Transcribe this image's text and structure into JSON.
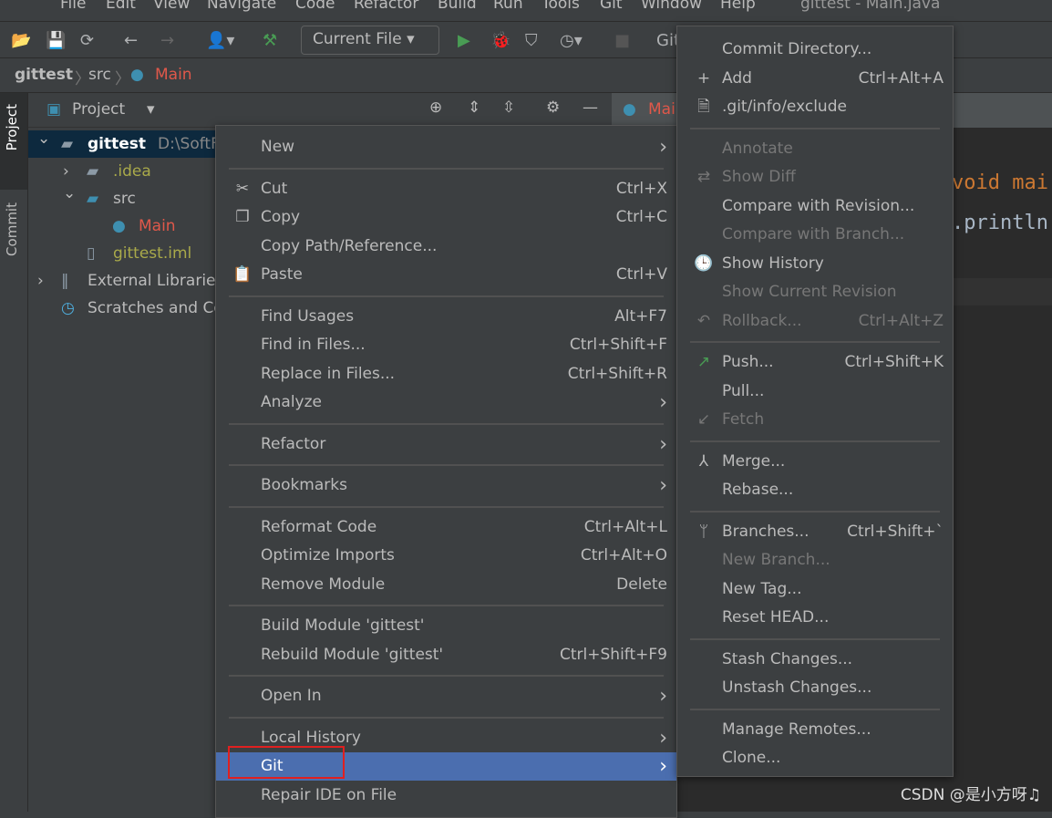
{
  "menubar": [
    "File",
    "Edit",
    "View",
    "Navigate",
    "Code",
    "Refactor",
    "Build",
    "Run",
    "Tools",
    "Git",
    "Window",
    "Help"
  ],
  "window_title": "gittest - Main.java",
  "toolbar": {
    "run_config": "Current File",
    "git_label": "Git:"
  },
  "breadcrumb": [
    "gittest",
    "src",
    "Main"
  ],
  "side_tabs": {
    "project": "Project",
    "commit": "Commit"
  },
  "project_panel": {
    "title": "Project"
  },
  "tree": [
    {
      "label": "gittest",
      "extra": "D:\\SoftFi",
      "icon": "module-folder-icon",
      "expanded": true,
      "color": "#ffffff",
      "indent": 0
    },
    {
      "label": ".idea",
      "icon": "folder-icon",
      "expanded": false,
      "color": "#a9a94a",
      "indent": 1
    },
    {
      "label": "src",
      "icon": "source-folder-icon",
      "expanded": true,
      "color": "#bbbbbb",
      "indent": 1
    },
    {
      "label": "Main",
      "icon": "java-class-icon",
      "color": "#e0584a",
      "indent": 2
    },
    {
      "label": "gittest.iml",
      "icon": "iml-file-icon",
      "color": "#a9a94a",
      "indent": 1
    },
    {
      "label": "External Librarie",
      "icon": "library-icon",
      "expanded": false,
      "color": "#bbbbbb",
      "indent": 0
    },
    {
      "label": "Scratches and Co",
      "icon": "scratches-icon",
      "color": "#bbbbbb",
      "indent": 0
    }
  ],
  "editor": {
    "tab": "Main",
    "code": [
      "void mai",
      ".println"
    ]
  },
  "context_menu": [
    {
      "label": "New",
      "submenu": true
    },
    {
      "sep": true
    },
    {
      "label": "Cut",
      "shortcut": "Ctrl+X",
      "icon": "✂"
    },
    {
      "label": "Copy",
      "shortcut": "Ctrl+C",
      "icon": "❐"
    },
    {
      "label": "Copy Path/Reference..."
    },
    {
      "label": "Paste",
      "shortcut": "Ctrl+V",
      "icon": "📋"
    },
    {
      "sep": true
    },
    {
      "label": "Find Usages",
      "shortcut": "Alt+F7"
    },
    {
      "label": "Find in Files...",
      "shortcut": "Ctrl+Shift+F"
    },
    {
      "label": "Replace in Files...",
      "shortcut": "Ctrl+Shift+R"
    },
    {
      "label": "Analyze",
      "submenu": true
    },
    {
      "sep": true
    },
    {
      "label": "Refactor",
      "submenu": true
    },
    {
      "sep": true
    },
    {
      "label": "Bookmarks",
      "submenu": true
    },
    {
      "sep": true
    },
    {
      "label": "Reformat Code",
      "shortcut": "Ctrl+Alt+L"
    },
    {
      "label": "Optimize Imports",
      "shortcut": "Ctrl+Alt+O"
    },
    {
      "label": "Remove Module",
      "shortcut": "Delete"
    },
    {
      "sep": true
    },
    {
      "label": "Build Module 'gittest'"
    },
    {
      "label": "Rebuild Module 'gittest'",
      "shortcut": "Ctrl+Shift+F9"
    },
    {
      "sep": true
    },
    {
      "label": "Open In",
      "submenu": true
    },
    {
      "sep": true
    },
    {
      "label": "Local History",
      "submenu": true
    },
    {
      "label": "Git",
      "submenu": true,
      "selected": true
    },
    {
      "label": "Repair IDE on File"
    }
  ],
  "git_menu": [
    {
      "label": "Commit Directory..."
    },
    {
      "label": "Add",
      "shortcut": "Ctrl+Alt+A",
      "icon": "+"
    },
    {
      "label": ".git/info/exclude",
      "icon": "🗎"
    },
    {
      "sep": true
    },
    {
      "label": "Annotate",
      "disabled": true
    },
    {
      "label": "Show Diff",
      "disabled": true,
      "icon": "⇄"
    },
    {
      "label": "Compare with Revision..."
    },
    {
      "label": "Compare with Branch...",
      "disabled": true
    },
    {
      "label": "Show History",
      "icon": "🕒"
    },
    {
      "label": "Show Current Revision",
      "disabled": true
    },
    {
      "label": "Rollback...",
      "shortcut": "Ctrl+Alt+Z",
      "disabled": true,
      "icon": "↶"
    },
    {
      "sep": true
    },
    {
      "label": "Push...",
      "shortcut": "Ctrl+Shift+K",
      "icon": "↗"
    },
    {
      "label": "Pull..."
    },
    {
      "label": "Fetch",
      "disabled": true,
      "icon": "↙"
    },
    {
      "sep": true
    },
    {
      "label": "Merge...",
      "icon": "⅄"
    },
    {
      "label": "Rebase..."
    },
    {
      "sep": true
    },
    {
      "label": "Branches...",
      "shortcut": "Ctrl+Shift+`",
      "icon": "ᛘ"
    },
    {
      "label": "New Branch...",
      "disabled": true
    },
    {
      "label": "New Tag..."
    },
    {
      "label": "Reset HEAD..."
    },
    {
      "sep": true
    },
    {
      "label": "Stash Changes..."
    },
    {
      "label": "Unstash Changes..."
    },
    {
      "sep": true
    },
    {
      "label": "Manage Remotes..."
    },
    {
      "label": "Clone..."
    }
  ],
  "watermark": "CSDN @是小方呀♫",
  "colors": {
    "accent": "#4b6eaf",
    "highlight_box": "#e02020",
    "run_green": "#499c54"
  }
}
